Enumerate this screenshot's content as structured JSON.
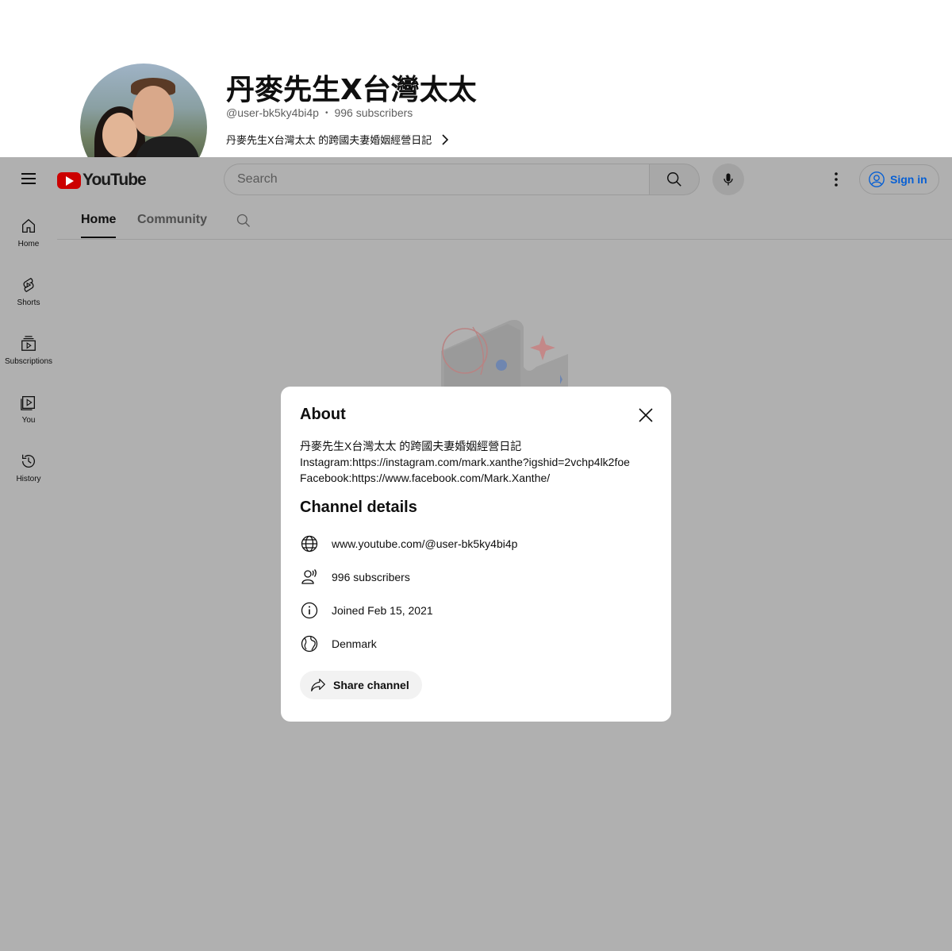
{
  "channel": {
    "title": "丹麥先生X台灣太太",
    "handle": "@user-bk5ky4bi4p",
    "separator": "•",
    "subscribers": "996 subscribers",
    "description_snippet": "丹麥先生X台灣太太 的跨國夫妻婚姻經營日記"
  },
  "masthead": {
    "logo_text": "YouTube",
    "search_placeholder": "Search",
    "sign_in_label": "Sign in"
  },
  "guide": {
    "items": [
      {
        "label": "Home",
        "icon": "home-icon"
      },
      {
        "label": "Shorts",
        "icon": "shorts-icon"
      },
      {
        "label": "Subscriptions",
        "icon": "subscriptions-icon"
      },
      {
        "label": "You",
        "icon": "you-icon"
      },
      {
        "label": "History",
        "icon": "history-icon"
      }
    ]
  },
  "tabs": [
    {
      "label": "Home",
      "active": true
    },
    {
      "label": "Community",
      "active": false
    }
  ],
  "about_dialog": {
    "title": "About",
    "description": "丹麥先生X台灣太太 的跨國夫妻婚姻經營日記\nInstagram:https://instagram.com/mark.xanthe?igshid=2vchp4lk2foe\nFacebook:https://www.facebook.com/Mark.Xanthe/",
    "details_title": "Channel details",
    "details": [
      {
        "icon": "globe-icon",
        "text": "www.youtube.com/@user-bk5ky4bi4p"
      },
      {
        "icon": "subscribers-icon",
        "text": "996 subscribers"
      },
      {
        "icon": "info-icon",
        "text": "Joined Feb 15, 2021"
      },
      {
        "icon": "location-globe-icon",
        "text": "Denmark"
      }
    ],
    "share_label": "Share channel"
  },
  "colors": {
    "overlay": "#b0b0b0",
    "brand_red": "#cc0000",
    "link_blue": "#065fd4"
  }
}
